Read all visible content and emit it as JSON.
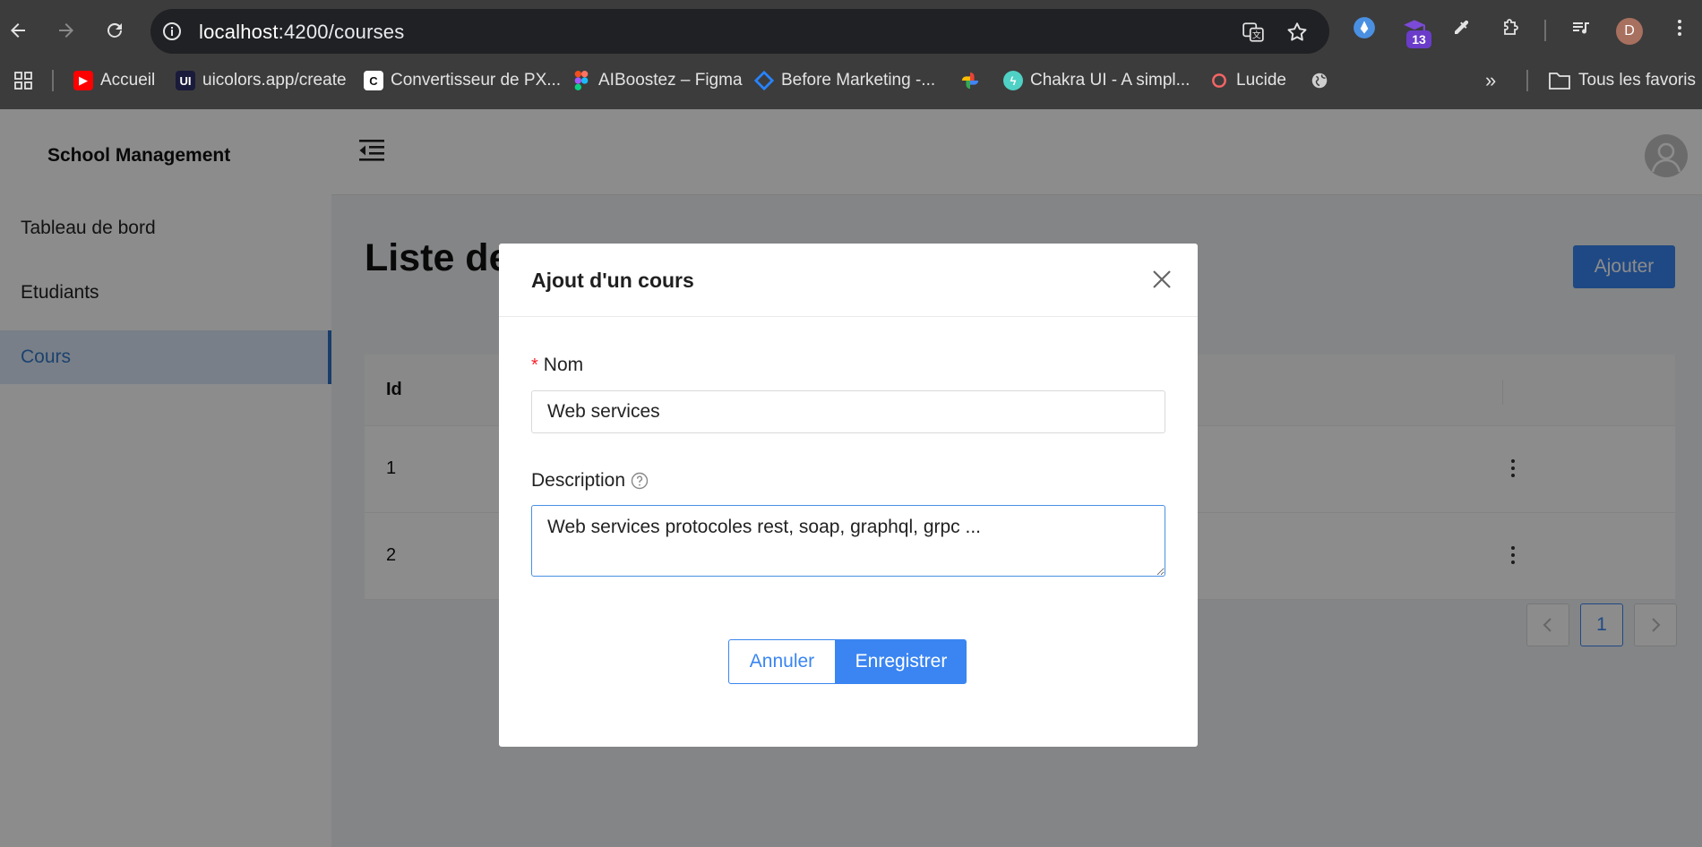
{
  "browser": {
    "url_host": "localhost",
    "url_path": ":4200/courses",
    "extension_badge": "13",
    "profile_initial": "D",
    "bookmarks": [
      {
        "label": "Accueil",
        "icon": "youtube-icon",
        "color": "#ff0000"
      },
      {
        "label": "uicolors.app/create",
        "icon": "uicolors-icon",
        "color": "#1a1a3a"
      },
      {
        "label": "Convertisseur de PX...",
        "icon": "convertisseur-icon",
        "color": "#ffffff"
      },
      {
        "label": "AIBoostez – Figma",
        "icon": "figma-icon",
        "color": "#f24e1e"
      },
      {
        "label": "Before Marketing -...",
        "icon": "jira-icon",
        "color": "#2684ff"
      },
      {
        "label": "",
        "icon": "google-photos-icon",
        "color": "#fbbc04"
      },
      {
        "label": "Chakra UI - A simpl...",
        "icon": "chakra-icon",
        "color": "#4fd1c5"
      },
      {
        "label": "Lucide",
        "icon": "lucide-icon",
        "color": "#f56565"
      },
      {
        "label": "",
        "icon": "globe-icon",
        "color": "#cccccc"
      }
    ],
    "all_bookmarks_label": "Tous les favoris"
  },
  "app": {
    "brand": "School Management",
    "sidebar": [
      {
        "label": "Tableau de bord",
        "active": false
      },
      {
        "label": "Etudiants",
        "active": false
      },
      {
        "label": "Cours",
        "active": true
      }
    ],
    "page_title": "Liste des cours",
    "add_button": "Ajouter",
    "table": {
      "headers": [
        "Id"
      ],
      "rows": [
        {
          "id": "1"
        },
        {
          "id": "2"
        }
      ]
    },
    "pagination": {
      "current": "1"
    }
  },
  "modal": {
    "title": "Ajout d'un cours",
    "name_label": "Nom",
    "name_value": "Web services",
    "description_label": "Description",
    "description_value": "Web services protocoles rest, soap, graphql, grpc ...",
    "cancel_label": "Annuler",
    "save_label": "Enregistrer"
  },
  "colors": {
    "primary": "#3a85f2",
    "sidebar_active_bg": "#dbe8f8",
    "required": "#f5222d"
  }
}
